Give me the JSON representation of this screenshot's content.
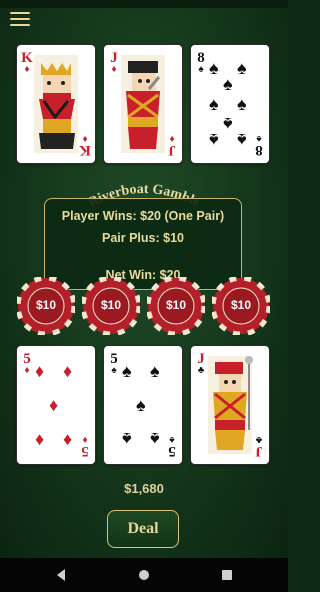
{
  "game": {
    "title": "Riverboat Gamble"
  },
  "dealer_cards": [
    {
      "rank": "K",
      "suit": "diamonds",
      "suit_symbol": "♦"
    },
    {
      "rank": "J",
      "suit": "diamonds",
      "suit_symbol": "♦"
    },
    {
      "rank": "8",
      "suit": "spades",
      "suit_symbol": "♠"
    }
  ],
  "player_cards": [
    {
      "rank": "5",
      "suit": "diamonds",
      "suit_symbol": "♦"
    },
    {
      "rank": "5",
      "suit": "spades",
      "suit_symbol": "♠"
    },
    {
      "rank": "J",
      "suit": "clubs",
      "suit_symbol": "♣"
    }
  ],
  "result": {
    "player_wins": "Player Wins: $20 (One Pair)",
    "pair_plus": "Pair Plus: $10",
    "net_win": "Net Win: $20"
  },
  "chips": [
    {
      "label": "$10"
    },
    {
      "label": "$10"
    },
    {
      "label": "$10"
    },
    {
      "label": "$10"
    }
  ],
  "balance": "$1,680",
  "deal_button": "Deal",
  "colors": {
    "felt": "#163a1d",
    "gold": "#e8db9a",
    "chip_red": "#b3202a",
    "card_red": "#c8202a"
  },
  "icons": {
    "menu": "hamburger-menu-icon",
    "nav_back": "triangle-back-icon",
    "nav_home": "circle-home-icon",
    "nav_recents": "square-recents-icon"
  }
}
